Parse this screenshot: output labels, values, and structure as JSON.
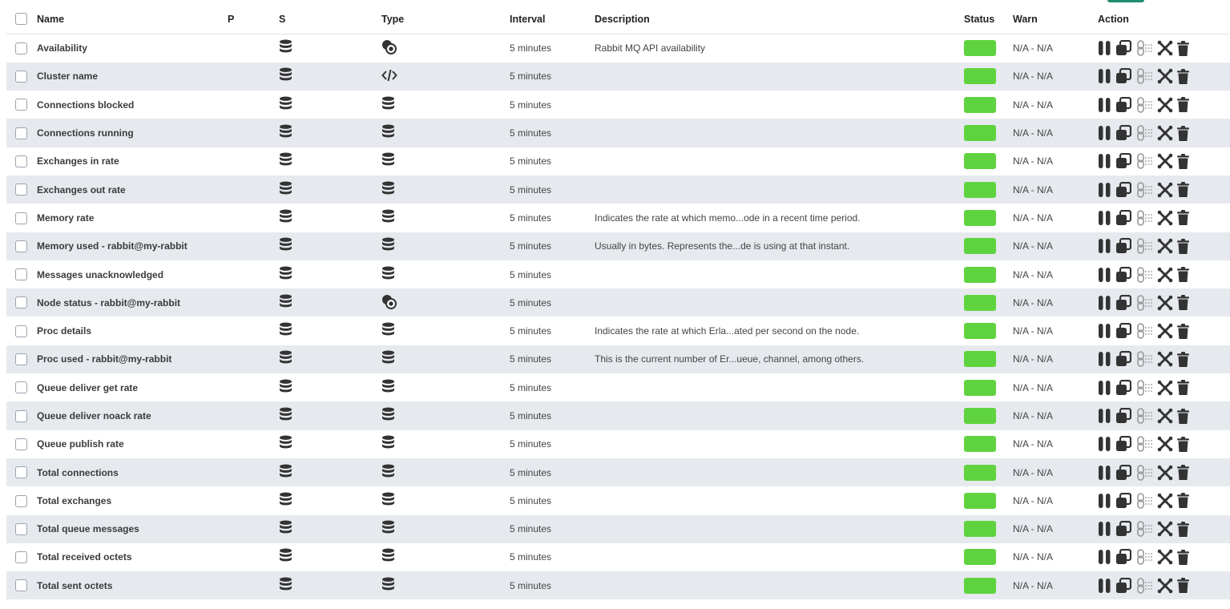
{
  "colors": {
    "status_ok": "#5fd33f",
    "icon_dark": "#333333",
    "row_alt": "#e6e9ee",
    "accent": "#1f8f71"
  },
  "header": {
    "name": "Name",
    "p": "P",
    "s": "S",
    "type": "Type",
    "interval": "Interval",
    "description": "Description",
    "status": "Status",
    "warn": "Warn",
    "action": "Action"
  },
  "modules": [
    {
      "name": "Availability",
      "s_icon": "database-icon",
      "type_icon": "proc-icon",
      "interval": "5 minutes",
      "description": "Rabbit MQ API availability",
      "status": "ok",
      "warn": "N/A - N/A"
    },
    {
      "name": "Cluster name",
      "s_icon": "database-icon",
      "type_icon": "code-icon",
      "interval": "5 minutes",
      "description": "",
      "status": "ok",
      "warn": "N/A - N/A"
    },
    {
      "name": "Connections blocked",
      "s_icon": "database-icon",
      "type_icon": "database-icon",
      "interval": "5 minutes",
      "description": "",
      "status": "ok",
      "warn": "N/A - N/A"
    },
    {
      "name": "Connections running",
      "s_icon": "database-icon",
      "type_icon": "database-icon",
      "interval": "5 minutes",
      "description": "",
      "status": "ok",
      "warn": "N/A - N/A"
    },
    {
      "name": "Exchanges in rate",
      "s_icon": "database-icon",
      "type_icon": "database-icon",
      "interval": "5 minutes",
      "description": "",
      "status": "ok",
      "warn": "N/A - N/A"
    },
    {
      "name": "Exchanges out rate",
      "s_icon": "database-icon",
      "type_icon": "database-icon",
      "interval": "5 minutes",
      "description": "",
      "status": "ok",
      "warn": "N/A - N/A"
    },
    {
      "name": "Memory rate",
      "s_icon": "database-icon",
      "type_icon": "database-icon",
      "interval": "5 minutes",
      "description": "Indicates the rate at which memo...ode in a recent time period.",
      "status": "ok",
      "warn": "N/A - N/A"
    },
    {
      "name": "Memory used - rabbit@my-rabbit",
      "s_icon": "database-icon",
      "type_icon": "database-icon",
      "interval": "5 minutes",
      "description": "Usually in bytes. Represents the...de is using at that instant.",
      "status": "ok",
      "warn": "N/A - N/A"
    },
    {
      "name": "Messages unacknowledged",
      "s_icon": "database-icon",
      "type_icon": "database-icon",
      "interval": "5 minutes",
      "description": "",
      "status": "ok",
      "warn": "N/A - N/A"
    },
    {
      "name": "Node status - rabbit@my-rabbit",
      "s_icon": "database-icon",
      "type_icon": "proc-icon",
      "interval": "5 minutes",
      "description": "",
      "status": "ok",
      "warn": "N/A - N/A"
    },
    {
      "name": "Proc details",
      "s_icon": "database-icon",
      "type_icon": "database-icon",
      "interval": "5 minutes",
      "description": "Indicates the rate at which Erla...ated per second on the node.",
      "status": "ok",
      "warn": "N/A - N/A"
    },
    {
      "name": "Proc used - rabbit@my-rabbit",
      "s_icon": "database-icon",
      "type_icon": "database-icon",
      "interval": "5 minutes",
      "description": "This is the current number of Er...ueue, channel, among others.",
      "status": "ok",
      "warn": "N/A - N/A"
    },
    {
      "name": "Queue deliver get rate",
      "s_icon": "database-icon",
      "type_icon": "database-icon",
      "interval": "5 minutes",
      "description": "",
      "status": "ok",
      "warn": "N/A - N/A"
    },
    {
      "name": "Queue deliver noack rate",
      "s_icon": "database-icon",
      "type_icon": "database-icon",
      "interval": "5 minutes",
      "description": "",
      "status": "ok",
      "warn": "N/A - N/A"
    },
    {
      "name": "Queue publish rate",
      "s_icon": "database-icon",
      "type_icon": "database-icon",
      "interval": "5 minutes",
      "description": "",
      "status": "ok",
      "warn": "N/A - N/A"
    },
    {
      "name": "Total connections",
      "s_icon": "database-icon",
      "type_icon": "database-icon",
      "interval": "5 minutes",
      "description": "",
      "status": "ok",
      "warn": "N/A - N/A"
    },
    {
      "name": "Total exchanges",
      "s_icon": "database-icon",
      "type_icon": "database-icon",
      "interval": "5 minutes",
      "description": "",
      "status": "ok",
      "warn": "N/A - N/A"
    },
    {
      "name": "Total queue messages",
      "s_icon": "database-icon",
      "type_icon": "database-icon",
      "interval": "5 minutes",
      "description": "",
      "status": "ok",
      "warn": "N/A - N/A"
    },
    {
      "name": "Total received octets",
      "s_icon": "database-icon",
      "type_icon": "database-icon",
      "interval": "5 minutes",
      "description": "",
      "status": "ok",
      "warn": "N/A - N/A"
    },
    {
      "name": "Total sent octets",
      "s_icon": "database-icon",
      "type_icon": "database-icon",
      "interval": "5 minutes",
      "description": "",
      "status": "ok",
      "warn": "N/A - N/A"
    }
  ],
  "actions": [
    "pause-icon",
    "copy-icon",
    "link-icon",
    "disable-icon",
    "trash-icon"
  ]
}
